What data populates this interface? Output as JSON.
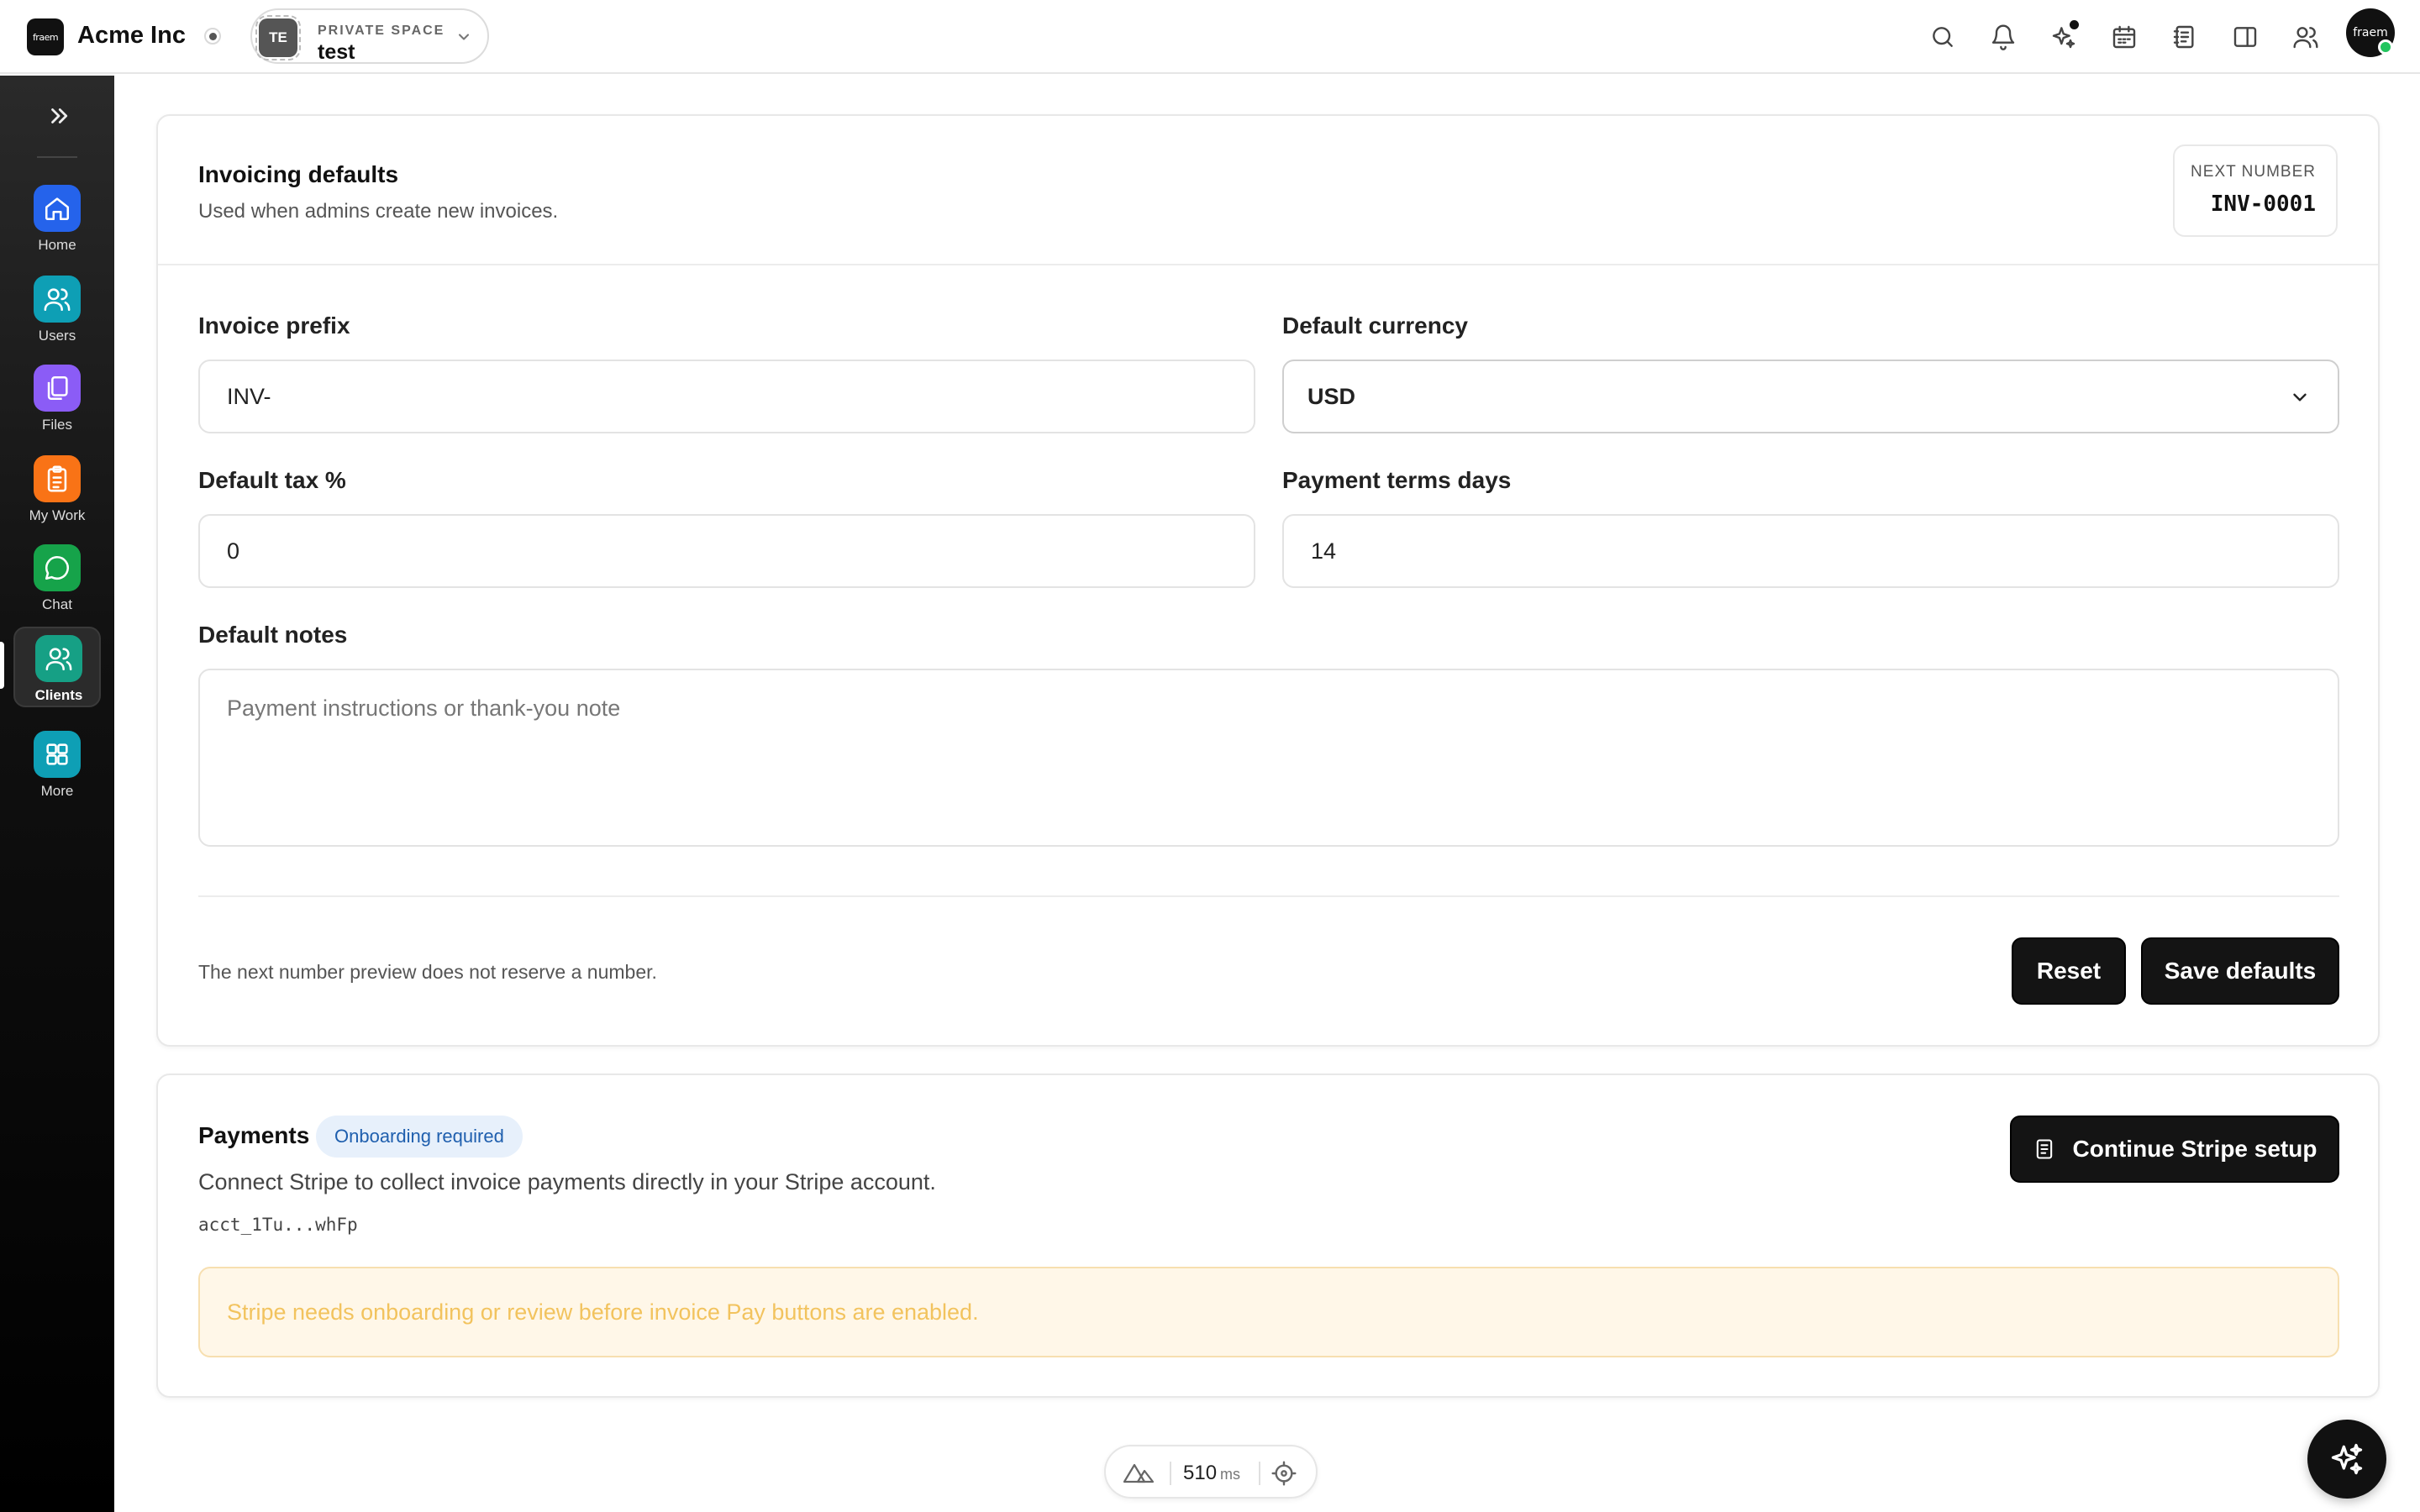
{
  "header": {
    "brand_logo_text": "fraem",
    "brand_name": "Acme Inc",
    "space": {
      "avatar_initials": "TE",
      "kicker": "PRIVATE SPACE",
      "name": "test"
    },
    "icons": [
      "search-icon",
      "bell-icon",
      "sparkles-icon",
      "calendar-icon",
      "notebook-icon",
      "panel-icon",
      "users-icon"
    ],
    "user_avatar_text": "fraem"
  },
  "sidebar": {
    "items": [
      {
        "label": "Home",
        "icon": "home-icon",
        "color": "#2563eb"
      },
      {
        "label": "Users",
        "icon": "users-icon",
        "color": "#0e9fb5"
      },
      {
        "label": "Files",
        "icon": "files-icon",
        "color": "#8b5cf6"
      },
      {
        "label": "My Work",
        "icon": "clipboard-icon",
        "color": "#f97316"
      },
      {
        "label": "Chat",
        "icon": "chat-icon",
        "color": "#16a34a"
      },
      {
        "label": "Clients",
        "icon": "clients-icon",
        "color": "#16a085",
        "active": true
      },
      {
        "label": "More",
        "icon": "grid-icon",
        "color": "#0e9fb5"
      }
    ]
  },
  "invoicing": {
    "title": "Invoicing defaults",
    "subtitle": "Used when admins create new invoices.",
    "next_number_label": "NEXT NUMBER",
    "next_number_value": "INV-0001",
    "prefix_label": "Invoice prefix",
    "prefix_value": "INV-",
    "currency_label": "Default currency",
    "currency_value": "USD",
    "tax_label": "Default tax %",
    "tax_value": "0",
    "terms_label": "Payment terms days",
    "terms_value": "14",
    "notes_label": "Default notes",
    "notes_placeholder": "Payment instructions or thank-you note",
    "footnote": "The next number preview does not reserve a number.",
    "reset_label": "Reset",
    "save_label": "Save defaults"
  },
  "payments": {
    "title": "Payments",
    "badge": "Onboarding required",
    "description": "Connect Stripe to collect invoice payments directly in your Stripe account.",
    "account_id": "acct_1Tu...whFp",
    "stripe_button": "Continue Stripe setup",
    "alert": "Stripe needs onboarding or review before invoice Pay buttons are enabled."
  },
  "perf": {
    "value": "510",
    "unit": "ms"
  }
}
